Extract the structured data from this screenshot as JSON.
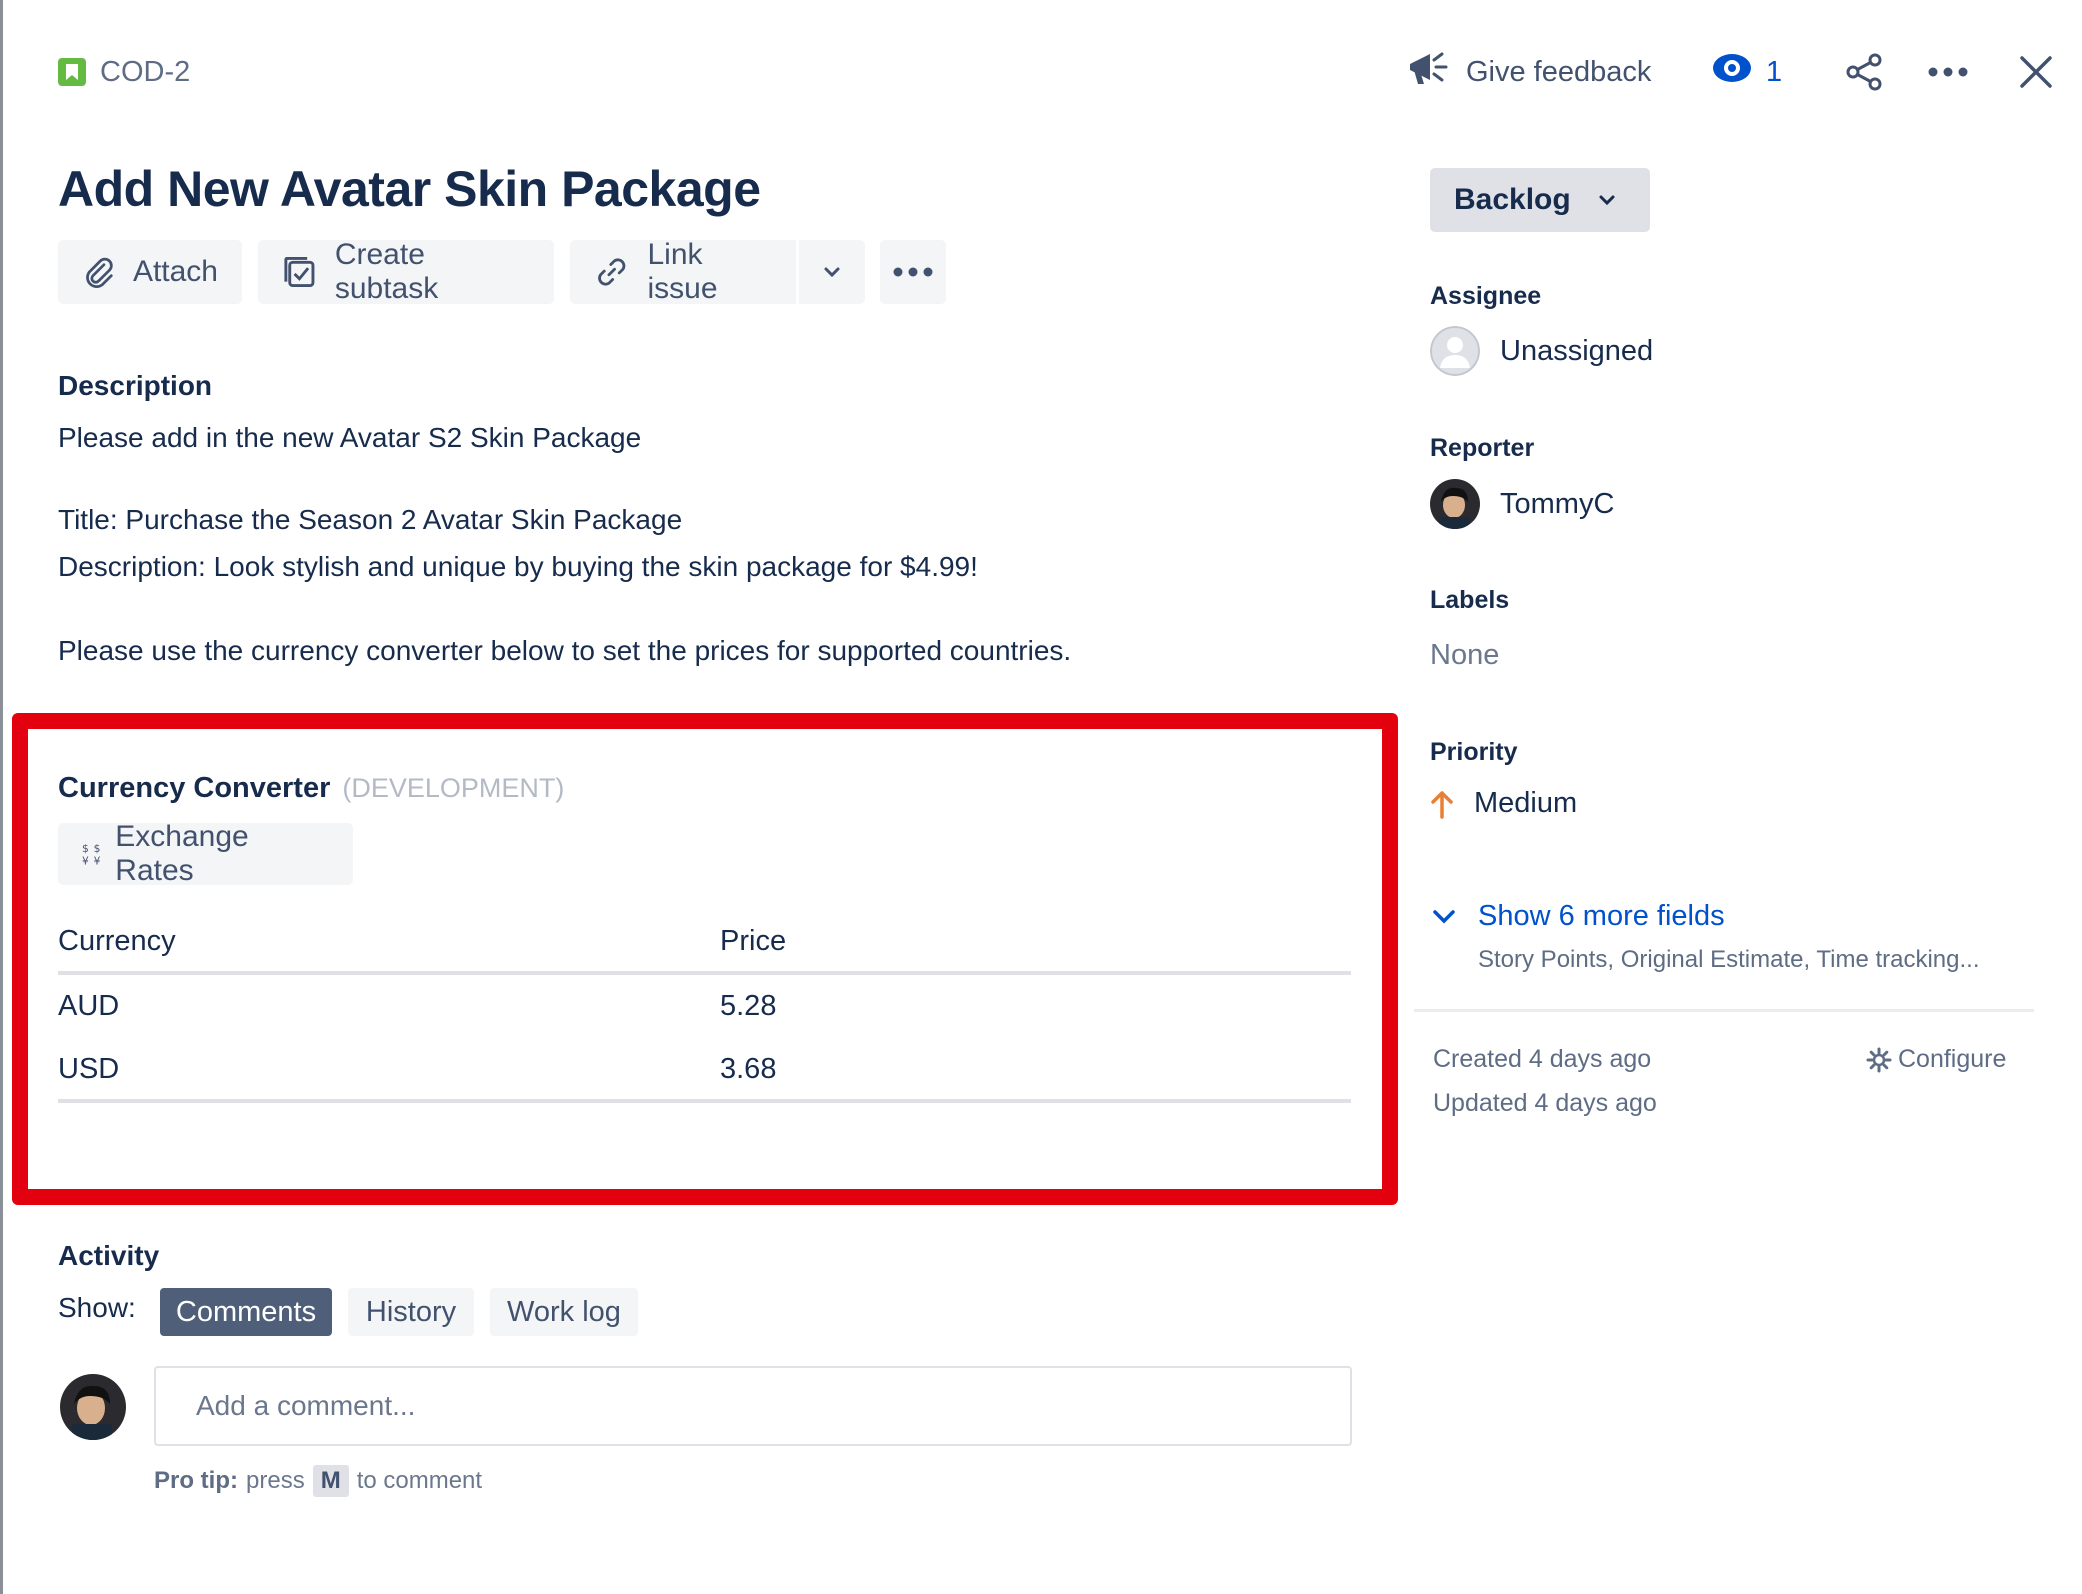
{
  "header": {
    "issue_key": "COD-2",
    "give_feedback": "Give feedback",
    "watchers_count": "1",
    "icons": [
      "story-icon",
      "megaphone-icon",
      "eye-icon",
      "share-icon",
      "more-icon",
      "close-icon"
    ]
  },
  "issue": {
    "title": "Add New Avatar Skin Package",
    "actions": {
      "attach": "Attach",
      "create_subtask": "Create subtask",
      "link_issue": "Link issue"
    }
  },
  "description": {
    "label": "Description",
    "lines": [
      "Please add in the new Avatar S2 Skin Package",
      "Title: Purchase the Season 2 Avatar Skin Package",
      "Description: Look stylish and unique by buying the skin package for $4.99!",
      "Please use the currency converter below to set the prices for supported countries."
    ]
  },
  "currency_converter": {
    "title": "Currency Converter",
    "environment": "(DEVELOPMENT)",
    "exchange_rates_button": "Exchange Rates",
    "columns": [
      "Currency",
      "Price"
    ],
    "rows": [
      {
        "currency": "AUD",
        "price": "5.28"
      },
      {
        "currency": "USD",
        "price": "3.68"
      }
    ]
  },
  "activity": {
    "label": "Activity",
    "show_label": "Show:",
    "tabs": [
      "Comments",
      "History",
      "Work log"
    ],
    "active_tab": "Comments",
    "comment_placeholder": "Add a comment...",
    "pro_tip_label": "Pro tip:",
    "pro_tip_press": "press",
    "pro_tip_key": "M",
    "pro_tip_rest": "to comment"
  },
  "sidebar": {
    "status": "Backlog",
    "assignee_label": "Assignee",
    "assignee": "Unassigned",
    "reporter_label": "Reporter",
    "reporter": "TommyC",
    "labels_label": "Labels",
    "labels": "None",
    "priority_label": "Priority",
    "priority": "Medium",
    "show_more": "Show 6 more fields",
    "show_more_sub": "Story Points, Original Estimate, Time tracking...",
    "created": "Created 4 days ago",
    "updated": "Updated 4 days ago",
    "configure": "Configure"
  },
  "colors": {
    "highlight_box": "#E3000F",
    "link_blue": "#0052CC",
    "story_green": "#65BA43",
    "priority_medium": "#E97F33",
    "active_tab": "#505F79"
  }
}
